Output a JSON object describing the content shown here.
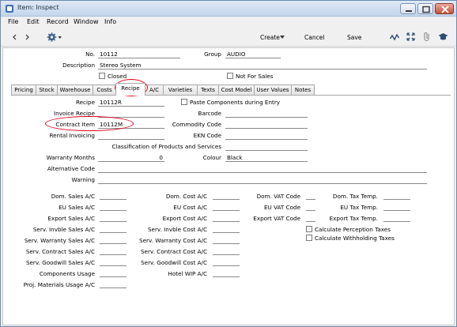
{
  "window": {
    "title": "Item: Inspect",
    "minimize": "minimize",
    "maximize": "maximize",
    "close": "close"
  },
  "menu": {
    "items": [
      "File",
      "Edit",
      "Record",
      "Window",
      "Info"
    ]
  },
  "toolbar": {
    "create": "Create",
    "cancel": "Cancel",
    "save": "Save"
  },
  "header": {
    "no_label": "No.",
    "no_value": "10112",
    "group_label": "Group",
    "group_value": "AUDIO",
    "description_label": "Description",
    "description_value": "Stereo System",
    "closed_label": "Closed",
    "not_for_sales_label": "Not For Sales"
  },
  "tabs": [
    "Pricing",
    "Stock",
    "Warehouse",
    "Costs",
    "Recipe",
    "A/C",
    "Varieties",
    "Texts",
    "Cost Model",
    "User Values",
    "Notes"
  ],
  "active_tab": "Recipe",
  "recipe": {
    "recipe_label": "Recipe",
    "recipe_value": "10112R",
    "paste_label": "Paste Components during Entry",
    "invoice_recipe_label": "Invoice Recipe",
    "barcode_label": "Barcode",
    "contract_item_label": "Contract Item",
    "contract_item_value": "10112M",
    "commodity_code_label": "Commodity Code",
    "rental_invoicing_label": "Rental Invoicing",
    "ekn_code_label": "EKN Code",
    "classification_label": "Classification of Products and Services",
    "warranty_months_label": "Warranty Months",
    "warranty_months_value": "0",
    "colour_label": "Colour",
    "colour_value": "Black",
    "alternative_code_label": "Alternative Code",
    "warning_label": "Warning"
  },
  "accounts": {
    "col1": [
      "Dom. Sales A/C",
      "EU Sales A/C",
      "Export Sales A/C",
      "Serv. Invble Sales A/C",
      "Serv. Warranty Sales A/C",
      "Serv. Contract Sales A/C",
      "Serv. Goodwill Sales A/C",
      "Components Usage",
      "Proj. Materials Usage A/C"
    ],
    "col2": [
      "Dom. Cost A/C",
      "EU Cost A/C",
      "Export Cost A/C",
      "Serv. Invble Cost A/C",
      "Serv. Warranty Cost A/C",
      "Serv. Contract Cost A/C",
      "Serv. Goodwill Cost A/C",
      "Hotel WIP A/C"
    ],
    "col3": [
      "Dom. VAT Code",
      "EU VAT Code",
      "Export VAT Code"
    ],
    "col4": [
      "Dom. Tax Temp.",
      "EU Tax Temp.",
      "Export Tax Temp."
    ],
    "calc_perception_label": "Calculate Perception Taxes",
    "calc_withholding_label": "Calculate Withholding Taxes"
  },
  "colors": {
    "highlight": "#e0001b",
    "titlebar": "#c4d6ec"
  }
}
